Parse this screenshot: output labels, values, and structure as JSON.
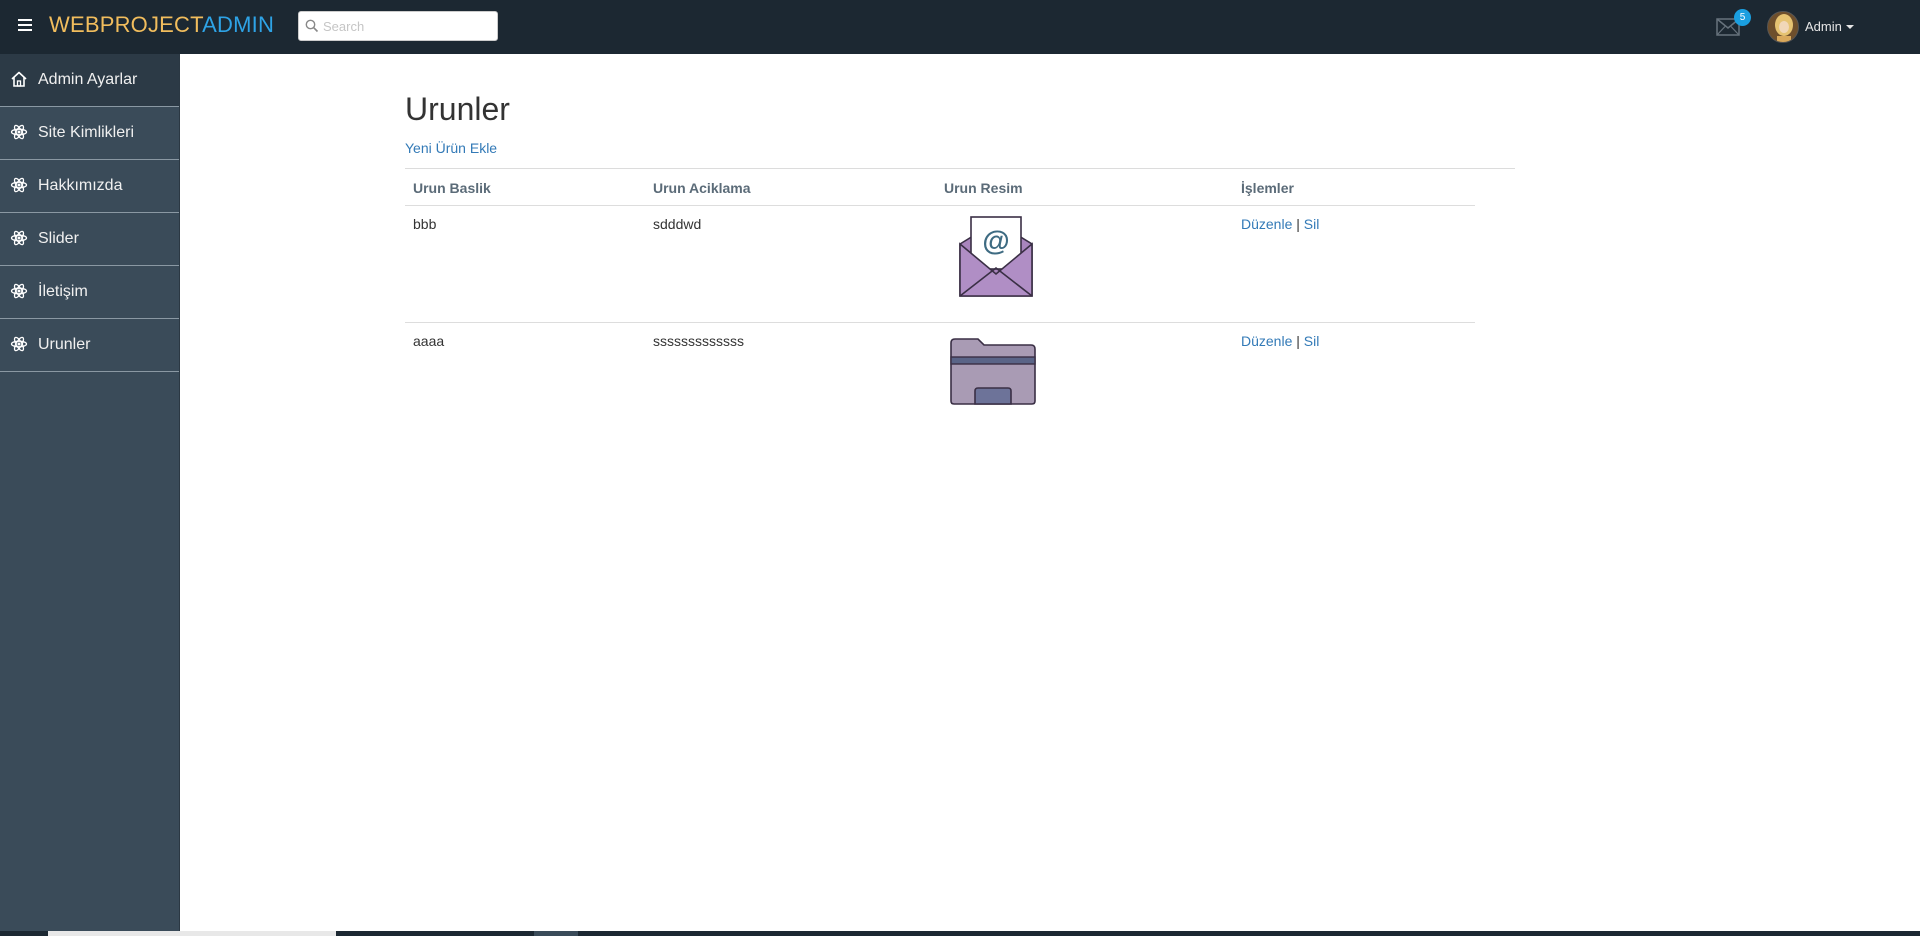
{
  "header": {
    "brand_part1": "WEBPROJECT",
    "brand_part2": "ADMIN",
    "search_placeholder": "Search",
    "mail_badge": "5",
    "user_name": "Admin"
  },
  "sidebar": {
    "items": [
      {
        "label": "Admin Ayarlar",
        "icon": "home-icon"
      },
      {
        "label": "Site Kimlikleri",
        "icon": "atom-icon"
      },
      {
        "label": "Hakkımızda",
        "icon": "atom-icon"
      },
      {
        "label": "Slider",
        "icon": "atom-icon"
      },
      {
        "label": "İletişim",
        "icon": "atom-icon"
      },
      {
        "label": "Urunler",
        "icon": "atom-icon"
      }
    ]
  },
  "main": {
    "title": "Urunler",
    "new_link": "Yeni Ürün Ekle",
    "columns": [
      "Urun Baslik",
      "Urun Aciklama",
      "Urun Resim",
      "İşlemler"
    ],
    "rows": [
      {
        "title": "bbb",
        "description": "sdddwd",
        "image": "email-envelope-icon",
        "edit": "Düzenle",
        "sep": "|",
        "delete": "Sil"
      },
      {
        "title": "aaaa",
        "description": "sssssssssssss",
        "image": "folder-icon",
        "edit": "Düzenle",
        "sep": "|",
        "delete": "Sil"
      }
    ]
  },
  "colors": {
    "topbar": "#1c2832",
    "sidebar": "#3a4b59",
    "brand_primary": "#f1bd5d",
    "brand_accent": "#2ea3e6",
    "link": "#337ab7"
  }
}
